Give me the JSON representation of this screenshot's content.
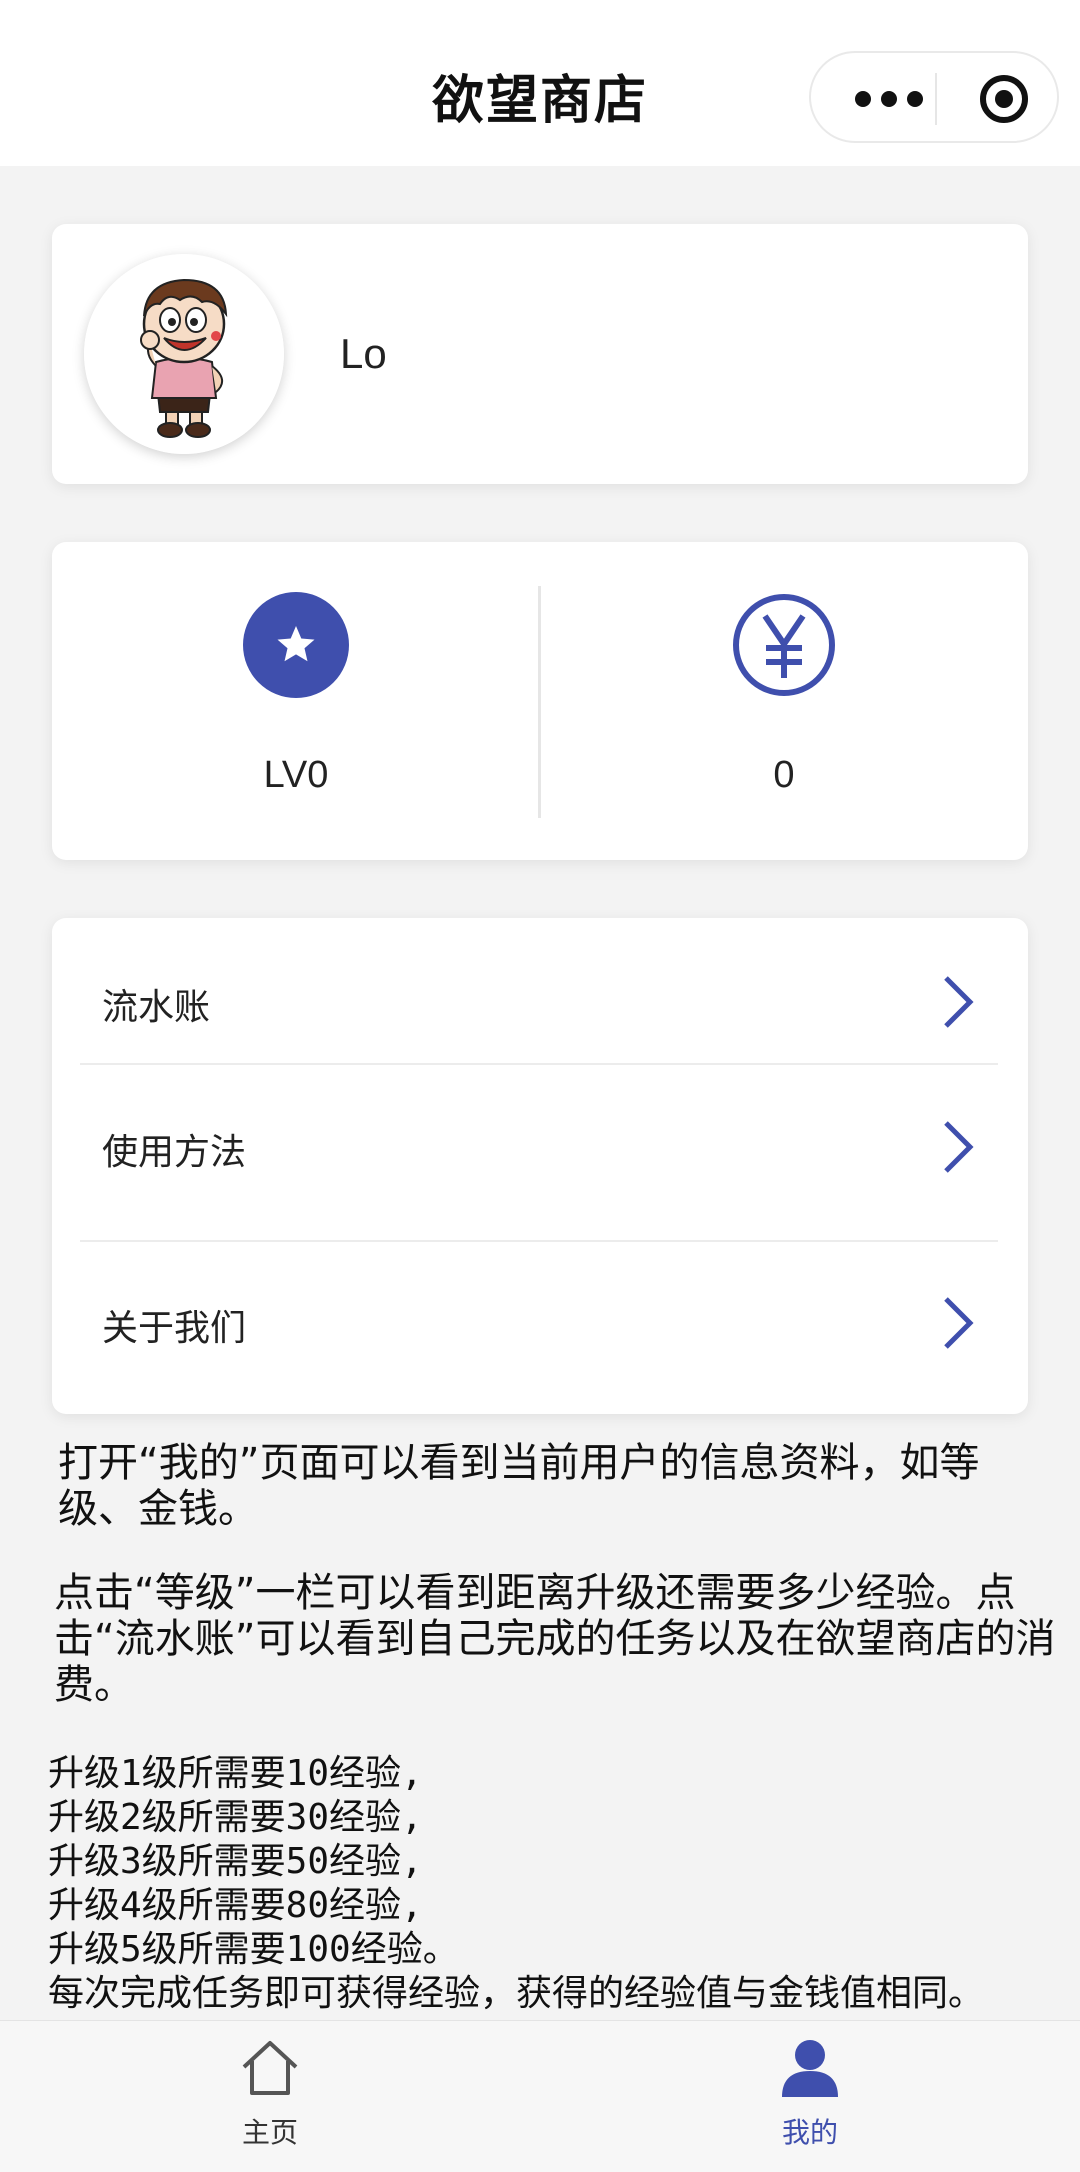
{
  "navbar": {
    "title": "欲望商店",
    "more_icon": "more-dots-icon",
    "target_icon": "record-target-icon"
  },
  "profile": {
    "username": "Lo",
    "avatar_icon": "cartoon-avatar"
  },
  "stats": {
    "level": {
      "icon": "star-icon",
      "value": "LV0"
    },
    "money": {
      "icon": "yen-icon",
      "value": "0"
    }
  },
  "menu": {
    "items": [
      {
        "label": "流水账"
      },
      {
        "label": "使用方法"
      },
      {
        "label": "关于我们"
      }
    ]
  },
  "help": {
    "p1": "打开“我的”页面可以看到当前用户的信息资料，如等级、金钱。",
    "p2": "点击“等级”一栏可以看到距离升级还需要多少经验。点击“流水账”可以看到自己完成的任务以及在欲望商店的消费。",
    "rules": [
      "升级1级所需要10经验,",
      "升级2级所需要30经验,",
      "升级3级所需要50经验,",
      "升级4级所需要80经验,",
      "升级5级所需要100经验。",
      "每次完成任务即可获得经验，获得的经验值与金钱值相同。"
    ]
  },
  "tabbar": {
    "home": {
      "label": "主页",
      "icon": "home-icon"
    },
    "mine": {
      "label": "我的",
      "icon": "person-icon"
    }
  },
  "colors": {
    "accent": "#3f4fad",
    "background": "#f3f3f3",
    "tab_inactive": "#333333"
  }
}
